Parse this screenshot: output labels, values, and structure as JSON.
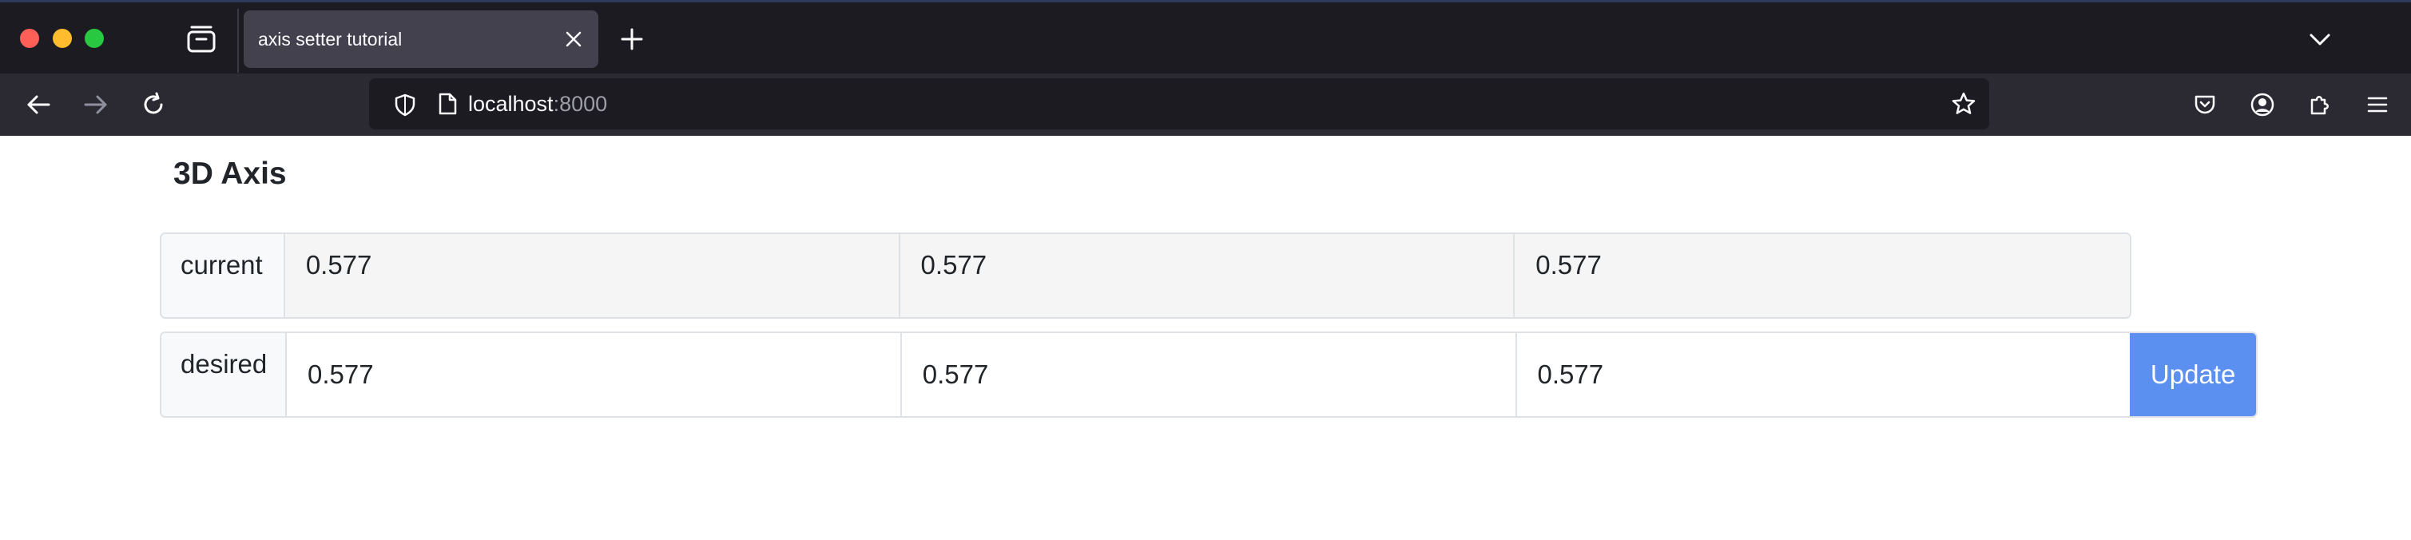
{
  "browser": {
    "tab": {
      "title": "axis setter tutorial"
    },
    "url": {
      "host": "localhost",
      "port": ":8000"
    },
    "icons": {
      "tab_overview": "tab-overview-icon",
      "close": "close-icon",
      "new_tab": "plus-icon",
      "tabs_list": "chevron-down-icon",
      "back": "arrow-left-icon",
      "forward": "arrow-right-icon",
      "reload": "reload-icon",
      "shield": "shield-icon",
      "page": "page-icon",
      "star": "star-icon",
      "pocket": "pocket-icon",
      "account": "account-icon",
      "extensions": "puzzle-icon",
      "menu": "hamburger-icon"
    },
    "colors": {
      "close": "#ff5f57",
      "minimize": "#febc2e",
      "zoom": "#28c840",
      "accent": "#5b8ff0"
    }
  },
  "page": {
    "title": "3D Axis",
    "current": {
      "label": "current",
      "values": [
        "0.577",
        "0.577",
        "0.577"
      ]
    },
    "desired": {
      "label": "desired",
      "values": [
        "0.577",
        "0.577",
        "0.577"
      ]
    },
    "update_label": "Update"
  }
}
